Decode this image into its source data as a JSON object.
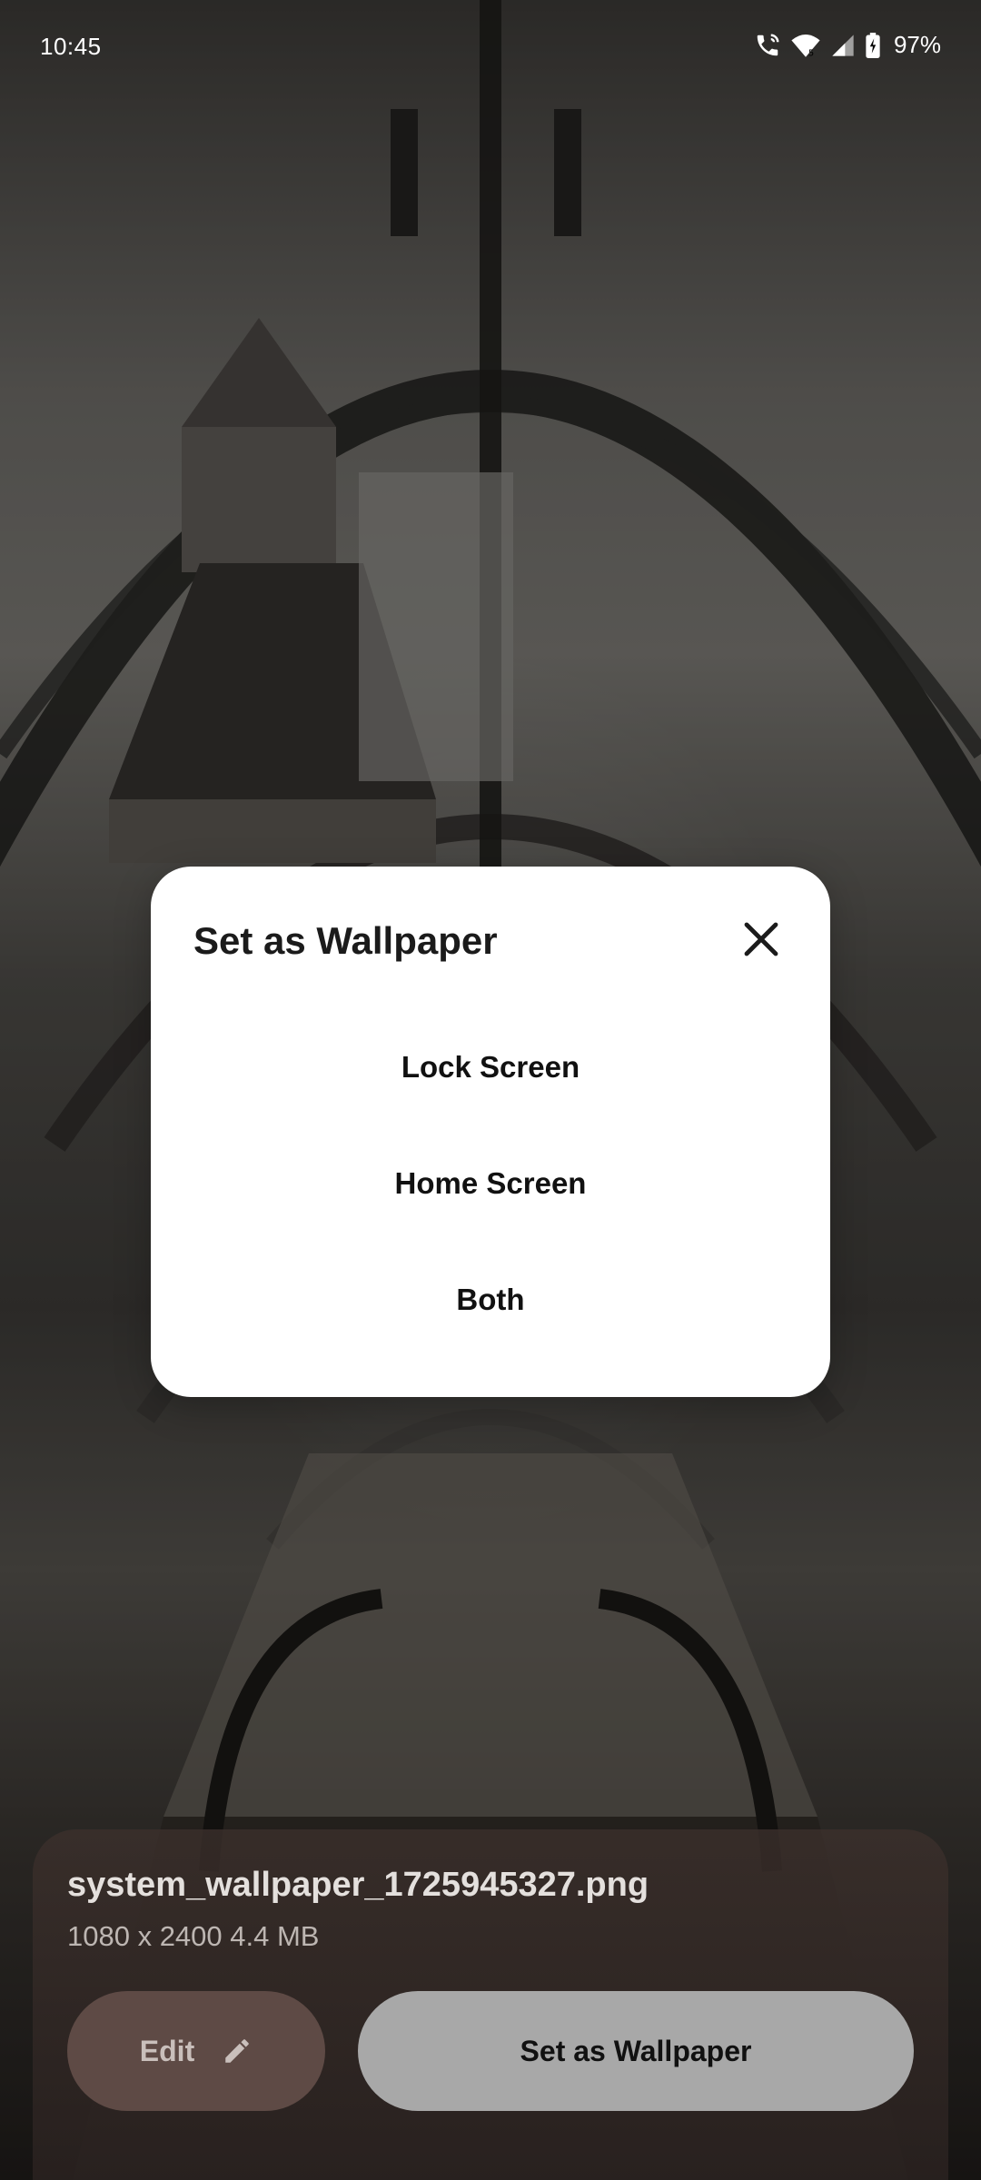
{
  "status_bar": {
    "time": "10:45",
    "battery": "97%",
    "icons": [
      "wifi-calling-icon",
      "wifi-icon",
      "signal-icon",
      "battery-charging-icon"
    ]
  },
  "dialog": {
    "title": "Set as Wallpaper",
    "close_icon": "close-icon",
    "options": [
      "Lock Screen",
      "Home Screen",
      "Both"
    ]
  },
  "file": {
    "name": "system_wallpaper_1725945327.png",
    "meta": "1080 x 2400 4.4 MB"
  },
  "actions": {
    "edit_label": "Edit",
    "edit_icon": "pencil-icon",
    "set_label": "Set as Wallpaper"
  },
  "colors": {
    "dialog_bg": "#ffffff",
    "edit_button_bg": "#5e4a45",
    "set_button_bg": "#a8a8a8"
  }
}
